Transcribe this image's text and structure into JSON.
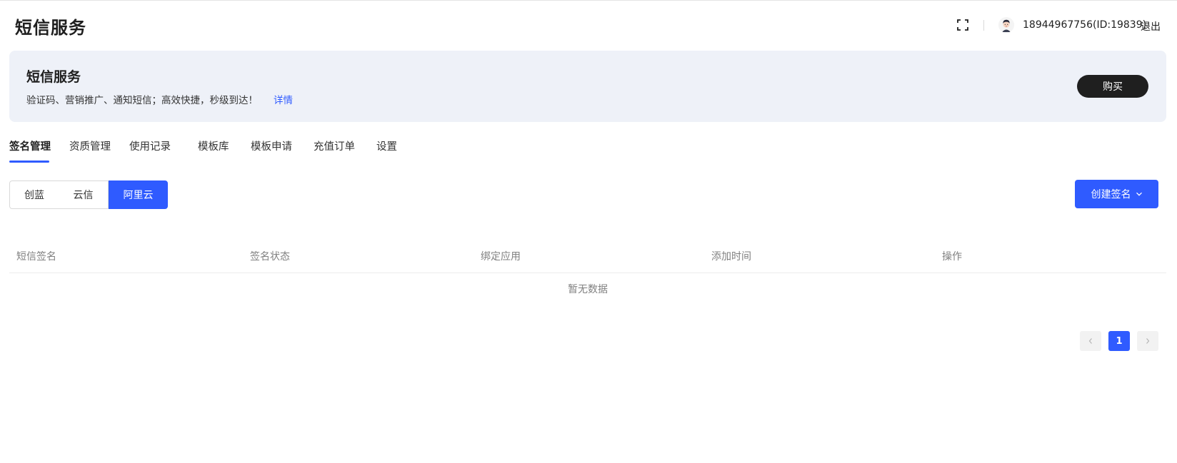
{
  "header": {
    "title": "短信服务",
    "user_label": "18944967756(ID:19839)",
    "logout_label": "退出"
  },
  "banner": {
    "title": "短信服务",
    "description": "验证码、营销推广、通知短信；高效快捷，秒级到达！",
    "details_link": "详情",
    "buy_label": "购买"
  },
  "tabs": [
    {
      "label": "签名管理",
      "active": true
    },
    {
      "label": "资质管理",
      "active": false
    },
    {
      "label": "使用记录",
      "active": false
    },
    {
      "label": "模板库",
      "active": false
    },
    {
      "label": "模板申请",
      "active": false
    },
    {
      "label": "充值订单",
      "active": false
    },
    {
      "label": "设置",
      "active": false
    }
  ],
  "providers": [
    {
      "label": "创蓝",
      "selected": false
    },
    {
      "label": "云信",
      "selected": false
    },
    {
      "label": "阿里云",
      "selected": true
    }
  ],
  "create_button": {
    "label": "创建签名",
    "icon": "chevron-down-icon"
  },
  "table": {
    "columns": [
      "短信签名",
      "签名状态",
      "绑定应用",
      "添加时间",
      "操作"
    ],
    "rows": [],
    "empty_text": "暂无数据"
  },
  "pagination": {
    "current_page": "1"
  },
  "colors": {
    "accent": "#2f5bff",
    "dark_button": "#1f1f1f",
    "banner_bg": "#eef1f8"
  }
}
